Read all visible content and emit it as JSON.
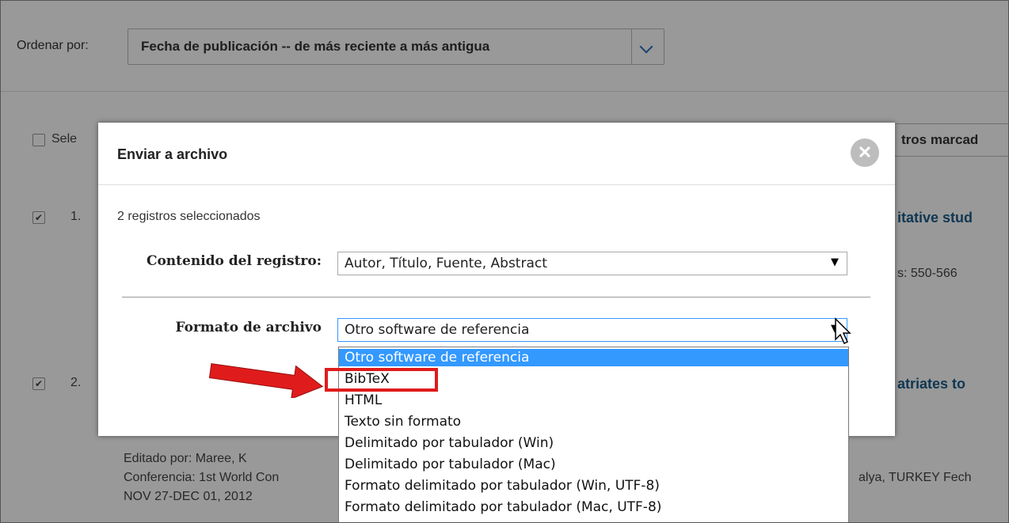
{
  "sort": {
    "label": "Ordenar por:",
    "value": "Fecha de publicación -- de más reciente a más antigua"
  },
  "background": {
    "select_all": "Sele",
    "marked_button": "tros marcad",
    "records": [
      {
        "num": "1.",
        "title_fragment": "itative stud",
        "pages": "s: 550-566",
        "checked": true
      },
      {
        "num": "2.",
        "title_fragment": "atriates to",
        "checked": true
      }
    ],
    "lines": [
      "Editado por: Maree, K",
      "Conferencia: 1st World Con",
      "alya, TURKEY Fech",
      "NOV 27-DEC 01, 2012"
    ]
  },
  "dialog": {
    "title": "Enviar a archivo",
    "close_icon": "close-icon",
    "selected_count": "2 registros seleccionados",
    "content_label": "Contenido del registro:",
    "content_value": "Autor, Título, Fuente, Abstract",
    "format_label": "Formato de archivo",
    "format_value": "Otro software de referencia",
    "format_options": [
      "Otro software de referencia",
      "BibTeX",
      "HTML",
      "Texto sin formato",
      "Delimitado por tabulador (Win)",
      "Delimitado por tabulador (Mac)",
      "Formato delimitado por tabulador (Win, UTF-8)",
      "Formato delimitado por tabulador (Mac, UTF-8)"
    ],
    "highlighted_option_index": 0
  },
  "colors": {
    "link": "#1d5e8a",
    "selection": "#3399ff",
    "annotation": "#e01b1b"
  }
}
